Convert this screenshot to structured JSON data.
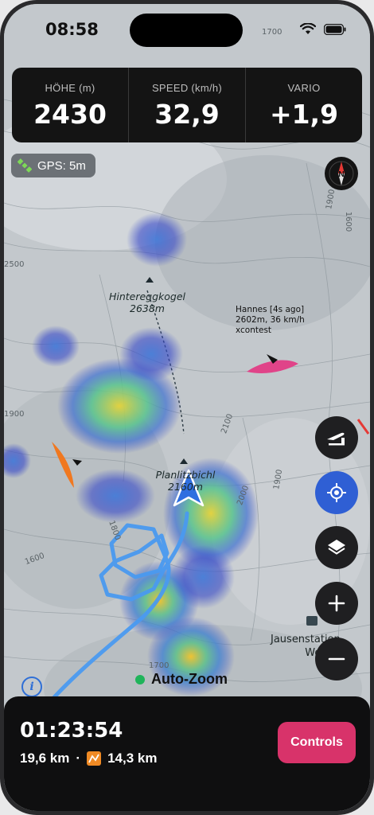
{
  "status_bar": {
    "time": "08:58"
  },
  "stats": [
    {
      "label": "HÖHE (m)",
      "value": "2430"
    },
    {
      "label": "SPEED (km/h)",
      "value": "32,9"
    },
    {
      "label": "VARIO",
      "value": "+1,9"
    }
  ],
  "gps": {
    "label": "GPS: 5m"
  },
  "compass": {
    "letter": "N"
  },
  "map": {
    "peaks": [
      {
        "name": "Hintereggkogel",
        "elevation": "2638m"
      },
      {
        "name": "Planlitzbichl",
        "elevation": "2160m"
      }
    ],
    "pilot": {
      "line1": "Hannes [4s ago]",
      "line2": "2602m, 36 km/h",
      "line3": "xcontest"
    },
    "poi": {
      "line1": "Jausenstation",
      "line2": "Woden"
    },
    "contours": [
      "1700",
      "1900",
      "1600",
      "2500",
      "1900",
      "2100",
      "1900",
      "2000",
      "1700",
      "1600",
      "1800"
    ]
  },
  "auto_zoom": {
    "label": "Auto-Zoom"
  },
  "flight": {
    "duration": "01:23:54",
    "distance": "19,6 km",
    "separator": "·",
    "xc_distance": "14,3 km",
    "controls_label": "Controls"
  },
  "icons": [
    "gps-satellite-icon",
    "compass-icon",
    "takeoff-icon",
    "locate-icon",
    "layers-icon",
    "zoom-in-icon",
    "zoom-out-icon",
    "info-icon",
    "xc-distance-icon",
    "wifi-icon",
    "battery-icon"
  ],
  "colors": {
    "accent_blue": "#2f5fd4",
    "controls_pink": "#d8336a",
    "panel": "#141414"
  }
}
